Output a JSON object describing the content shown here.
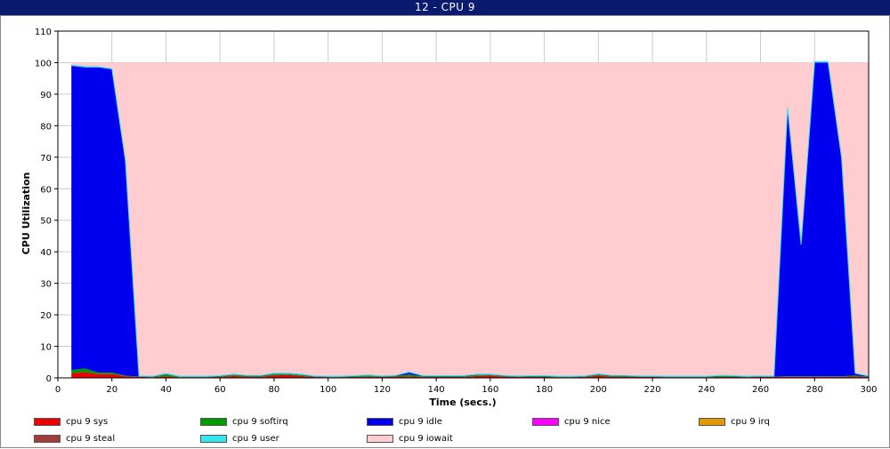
{
  "window": {
    "title": "12 - CPU 9"
  },
  "chart_data": {
    "type": "area",
    "title": "",
    "xlabel": "Time (secs.)",
    "ylabel": "CPU Utilization",
    "xlim": [
      0,
      300
    ],
    "ylim": [
      0,
      110
    ],
    "x_ticks": [
      0,
      20,
      40,
      60,
      80,
      100,
      120,
      140,
      160,
      180,
      200,
      220,
      240,
      260,
      280,
      300
    ],
    "y_ticks": [
      0,
      10,
      20,
      30,
      40,
      50,
      60,
      70,
      80,
      90,
      100,
      110
    ],
    "grid": true,
    "stacked": true,
    "legend_position": "bottom",
    "x": [
      5,
      10,
      15,
      20,
      25,
      30,
      35,
      40,
      45,
      50,
      55,
      60,
      65,
      70,
      75,
      80,
      85,
      90,
      95,
      100,
      105,
      110,
      115,
      120,
      125,
      130,
      135,
      140,
      145,
      150,
      155,
      160,
      165,
      170,
      175,
      180,
      185,
      190,
      195,
      200,
      205,
      210,
      215,
      220,
      225,
      230,
      235,
      240,
      245,
      250,
      255,
      260,
      265,
      270,
      275,
      280,
      285,
      290,
      295,
      300
    ],
    "series": [
      {
        "name": "cpu 9 sys",
        "color": "#ee0000",
        "values": [
          1.5,
          1.8,
          1.2,
          1.2,
          0.5,
          0.3,
          0.2,
          0.5,
          0.2,
          0.2,
          0.2,
          0.3,
          0.6,
          0.4,
          0.4,
          0.8,
          0.9,
          0.6,
          0.3,
          0.2,
          0.2,
          0.3,
          0.4,
          0.3,
          0.4,
          0.5,
          0.3,
          0.3,
          0.3,
          0.3,
          0.6,
          0.7,
          0.4,
          0.3,
          0.3,
          0.3,
          0.2,
          0.2,
          0.3,
          0.7,
          0.4,
          0.4,
          0.3,
          0.3,
          0.2,
          0.2,
          0.2,
          0.2,
          0.3,
          0.3,
          0.2,
          0.3,
          0.3,
          0.3,
          0.3,
          0.3,
          0.3,
          0.3,
          0.5,
          0.3
        ]
      },
      {
        "name": "cpu 9 softirq",
        "color": "#009900",
        "values": [
          1.0,
          1.2,
          0.5,
          0.5,
          0.2,
          0.1,
          0.1,
          0.6,
          0.1,
          0.1,
          0.1,
          0.2,
          0.3,
          0.2,
          0.2,
          0.4,
          0.3,
          0.3,
          0.1,
          0.1,
          0.1,
          0.2,
          0.3,
          0.1,
          0.2,
          0.6,
          0.2,
          0.2,
          0.2,
          0.2,
          0.3,
          0.2,
          0.2,
          0.1,
          0.2,
          0.2,
          0.1,
          0.1,
          0.1,
          0.3,
          0.2,
          0.2,
          0.1,
          0.1,
          0.1,
          0.1,
          0.1,
          0.1,
          0.3,
          0.2,
          0.1,
          0.1,
          0.1,
          0.2,
          0.2,
          0.2,
          0.2,
          0.2,
          0.3,
          0.1
        ]
      },
      {
        "name": "cpu 9 idle",
        "color": "#0000ee",
        "values": [
          96.5,
          95.5,
          96.8,
          96.2,
          68.0,
          0.1,
          0.1,
          0.1,
          0.1,
          0.1,
          0.1,
          0.1,
          0.1,
          0.1,
          0.1,
          0.1,
          0.1,
          0.1,
          0.1,
          0.1,
          0.1,
          0.1,
          0.1,
          0.1,
          0.1,
          0.6,
          0.1,
          0.1,
          0.1,
          0.1,
          0.1,
          0.1,
          0.1,
          0.1,
          0.1,
          0.1,
          0.1,
          0.1,
          0.1,
          0.1,
          0.1,
          0.1,
          0.1,
          0.1,
          0.1,
          0.1,
          0.1,
          0.1,
          0.1,
          0.1,
          0.1,
          0.1,
          0.1,
          85.0,
          41.5,
          99.5,
          99.5,
          69.0,
          0.5,
          0.1
        ]
      },
      {
        "name": "cpu 9 nice",
        "color": "#ff00ff",
        "values": [
          0,
          0,
          0,
          0,
          0,
          0,
          0,
          0,
          0,
          0,
          0,
          0,
          0,
          0,
          0,
          0,
          0,
          0,
          0,
          0,
          0,
          0,
          0,
          0,
          0,
          0,
          0,
          0,
          0,
          0,
          0,
          0,
          0,
          0,
          0,
          0,
          0,
          0,
          0,
          0,
          0,
          0,
          0,
          0,
          0,
          0,
          0,
          0,
          0,
          0,
          0,
          0,
          0,
          0,
          0,
          0,
          0,
          0,
          0,
          0
        ]
      },
      {
        "name": "cpu 9 irq",
        "color": "#e09a00",
        "values": [
          0,
          0,
          0,
          0,
          0,
          0,
          0,
          0,
          0,
          0,
          0,
          0,
          0,
          0,
          0,
          0,
          0,
          0,
          0,
          0,
          0,
          0,
          0,
          0,
          0,
          0,
          0,
          0,
          0,
          0,
          0,
          0,
          0,
          0,
          0,
          0,
          0,
          0,
          0,
          0,
          0,
          0,
          0,
          0,
          0,
          0,
          0,
          0,
          0,
          0,
          0,
          0,
          0,
          0,
          0,
          0,
          0,
          0,
          0,
          0
        ]
      },
      {
        "name": "cpu 9 steal",
        "color": "#a03c3c",
        "values": [
          0,
          0,
          0,
          0,
          0,
          0,
          0,
          0,
          0,
          0,
          0,
          0,
          0,
          0,
          0,
          0,
          0,
          0,
          0,
          0,
          0,
          0,
          0,
          0,
          0,
          0,
          0,
          0,
          0,
          0,
          0,
          0,
          0,
          0,
          0,
          0,
          0,
          0,
          0,
          0,
          0,
          0,
          0,
          0,
          0,
          0,
          0,
          0,
          0,
          0,
          0,
          0,
          0,
          0,
          0,
          0,
          0,
          0,
          0,
          0
        ]
      },
      {
        "name": "cpu 9 user",
        "color": "#33e6f0",
        "values": [
          0.2,
          0.3,
          0.2,
          0.2,
          0.2,
          0.1,
          0.1,
          0.2,
          0.1,
          0.1,
          0.1,
          0.1,
          0.2,
          0.1,
          0.1,
          0.2,
          0.2,
          0.2,
          0.1,
          0.1,
          0.1,
          0.1,
          0.1,
          0.1,
          0.1,
          0.2,
          0.1,
          0.1,
          0.1,
          0.1,
          0.2,
          0.2,
          0.1,
          0.1,
          0.1,
          0.1,
          0.1,
          0.1,
          0.1,
          0.2,
          0.1,
          0.1,
          0.1,
          0.1,
          0.1,
          0.1,
          0.1,
          0.1,
          0.1,
          0.1,
          0.1,
          0.1,
          0.1,
          0.3,
          0.3,
          0.3,
          0.3,
          0.3,
          0.2,
          0.1
        ]
      },
      {
        "name": "cpu 9 iowait",
        "color": "#ffccd0",
        "values": [
          0.8,
          1.2,
          1.3,
          1.9,
          31.1,
          99.4,
          99.5,
          98.6,
          99.5,
          99.5,
          99.5,
          99.3,
          98.8,
          99.2,
          99.2,
          98.5,
          98.5,
          98.8,
          99.4,
          99.5,
          99.5,
          99.3,
          99.1,
          99.4,
          99.2,
          98.1,
          99.3,
          99.3,
          99.3,
          99.3,
          98.8,
          98.8,
          99.2,
          99.4,
          99.3,
          99.3,
          99.5,
          99.5,
          99.4,
          98.7,
          99.2,
          99.2,
          99.4,
          99.4,
          99.5,
          99.5,
          99.5,
          99.5,
          99.2,
          99.3,
          99.5,
          99.4,
          99.4,
          14.2,
          57.7,
          0,
          0,
          30.2,
          98.5,
          99.4
        ]
      }
    ]
  }
}
